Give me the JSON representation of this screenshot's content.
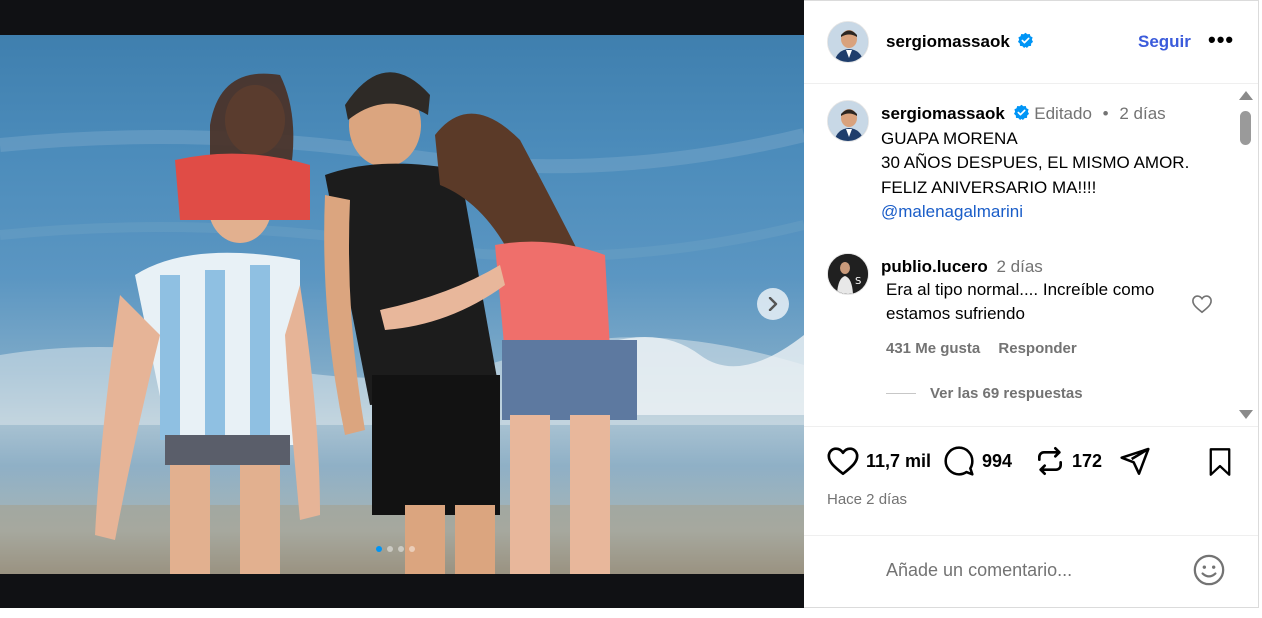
{
  "post": {
    "carousel_dots": 4,
    "active_dot": 0
  },
  "header": {
    "username": "sergiomassaok",
    "follow_label": "Seguir",
    "more_label": "•••"
  },
  "caption": {
    "username": "sergiomassaok",
    "edited_label": "Editado",
    "separator": "•",
    "time": "2 días",
    "lines": [
      "GUAPA MORENA",
      "30 AÑOS DESPUES, EL MISMO AMOR.",
      "FELIZ ANIVERSARIO MA!!!!"
    ],
    "mention": "@malenagalmarini"
  },
  "comment": {
    "username": "publio.lucero",
    "time": "2 días",
    "text": "Era al tipo normal.... Increíble como estamos sufriendo",
    "likes_label": "431 Me gusta",
    "reply_label": "Responder",
    "view_replies_label": "Ver las 69 respuestas"
  },
  "actions": {
    "likes": "11,7 mil",
    "comments": "994",
    "reposts": "172",
    "time_label": "Hace 2 días"
  },
  "add_comment": {
    "placeholder": "Añade un comentario..."
  },
  "colors": {
    "follow_blue": "#3b5bdb",
    "mention_blue": "#1a5dc8",
    "verified_blue": "#0095f6",
    "muted": "#737373"
  }
}
